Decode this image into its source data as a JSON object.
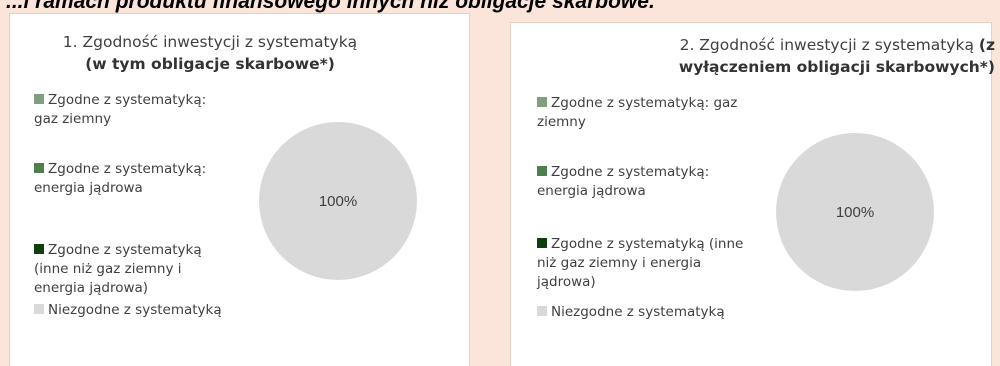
{
  "header": {
    "text": "...i ramach produktu finansowego innych niż obligacje skarbowe."
  },
  "chart_data": [
    {
      "type": "pie",
      "title": {
        "plain": "1. Zgodność inwestycji z systematyką ",
        "bold": "(w tym obligacje skarbowe*)"
      },
      "series": [
        {
          "categories": [
            "Zgodne z systematyką: gaz ziemny",
            "Zgodne z systematyką: energia jądrowa",
            "Zgodne z systematyką (inne niż gaz ziemny i energia jądrowa)",
            "Niezgodne z systematyką"
          ],
          "values": [
            0,
            0,
            0,
            100
          ],
          "colors": [
            "#7f9f7f",
            "#4f7f4f",
            "#0f3f0f",
            "#d9d9d9"
          ],
          "data_labels": [
            "",
            "",
            "",
            "100%"
          ]
        }
      ],
      "legend_position": "left"
    },
    {
      "type": "pie",
      "title": {
        "plain": "2. Zgodność inwestycji z systematyką ",
        "bold": "(z wyłączeniem obligacji skarbowych*)"
      },
      "series": [
        {
          "categories": [
            "Zgodne z systematyką: gaz ziemny",
            "Zgodne z systematyką: energia jądrowa",
            "Zgodne z systematyką (inne niż gaz ziemny i energia jądrowa)",
            "Niezgodne z systematyką"
          ],
          "values": [
            0,
            0,
            0,
            100
          ],
          "colors": [
            "#7f9f7f",
            "#4f7f4f",
            "#0f3f0f",
            "#d9d9d9"
          ],
          "data_labels": [
            "",
            "",
            "",
            "100%"
          ]
        }
      ],
      "legend_position": "left"
    }
  ]
}
